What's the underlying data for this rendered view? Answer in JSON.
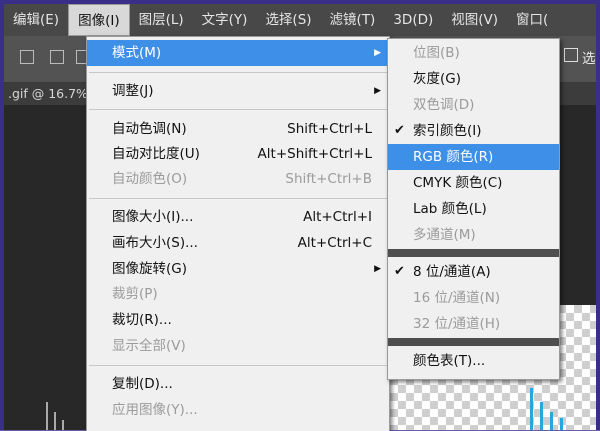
{
  "menubar": {
    "items": [
      "编辑(E)",
      "图像(I)",
      "图层(L)",
      "文字(Y)",
      "选择(S)",
      "滤镜(T)",
      "3D(D)",
      "视图(V)",
      "窗口("
    ]
  },
  "optionsbar": {
    "partial_label": "选"
  },
  "document_tab": {
    "title": ".gif @ 16.7%"
  },
  "image_menu": {
    "groups": [
      [
        {
          "label": "模式(M)",
          "submenu": true,
          "highlighted": true
        }
      ],
      [
        {
          "label": "调整(J)",
          "submenu": true
        }
      ],
      [
        {
          "label": "自动色调(N)",
          "shortcut": "Shift+Ctrl+L"
        },
        {
          "label": "自动对比度(U)",
          "shortcut": "Alt+Shift+Ctrl+L"
        },
        {
          "label": "自动颜色(O)",
          "shortcut": "Shift+Ctrl+B",
          "disabled": true
        }
      ],
      [
        {
          "label": "图像大小(I)...",
          "shortcut": "Alt+Ctrl+I"
        },
        {
          "label": "画布大小(S)...",
          "shortcut": "Alt+Ctrl+C"
        },
        {
          "label": "图像旋转(G)",
          "submenu": true
        },
        {
          "label": "裁剪(P)",
          "disabled": true
        },
        {
          "label": "裁切(R)..."
        },
        {
          "label": "显示全部(V)",
          "disabled": true
        }
      ],
      [
        {
          "label": "复制(D)..."
        },
        {
          "label": "应用图像(Y)...",
          "disabled": true
        }
      ]
    ]
  },
  "mode_submenu": {
    "groups": [
      [
        {
          "label": "位图(B)",
          "disabled": true
        },
        {
          "label": "灰度(G)"
        },
        {
          "label": "双色调(D)",
          "disabled": true
        },
        {
          "label": "索引颜色(I)",
          "checked": true
        },
        {
          "label": "RGB 颜色(R)",
          "highlighted": true
        },
        {
          "label": "CMYK 颜色(C)"
        },
        {
          "label": "Lab 颜色(L)"
        },
        {
          "label": "多通道(M)",
          "disabled": true
        }
      ],
      [
        {
          "label": "8 位/通道(A)",
          "checked": true
        },
        {
          "label": "16 位/通道(N)",
          "disabled": true
        },
        {
          "label": "32 位/通道(H)",
          "disabled": true
        }
      ],
      [
        {
          "label": "颜色表(T)..."
        }
      ]
    ]
  },
  "colors": {
    "highlight": "#3e8fe8",
    "menu_bg": "#f0f0f0",
    "menubar_bg": "#484848",
    "disabled": "#9b9b9b"
  }
}
